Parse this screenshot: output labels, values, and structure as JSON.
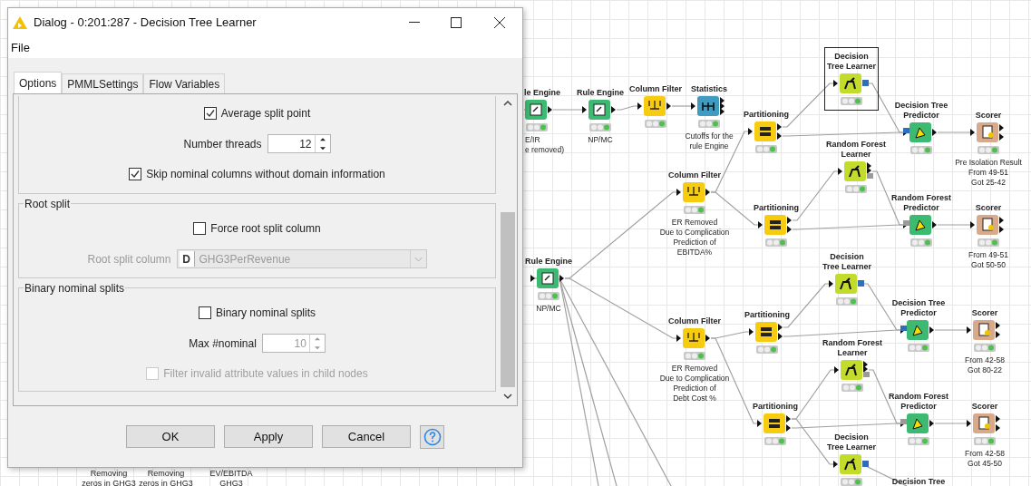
{
  "dialog": {
    "title": "Dialog - 0:201:287 - Decision Tree Learner",
    "menu": [
      "File"
    ],
    "tabs": [
      {
        "label": "Options",
        "selected": true
      },
      {
        "label": "PMMLSettings",
        "selected": false
      },
      {
        "label": "Flow Variables",
        "selected": false
      }
    ],
    "sections": [
      {
        "items": [
          {
            "kind": "checkbox",
            "label": "Average split point",
            "checked": true,
            "disabled": false
          },
          {
            "kind": "spinner",
            "label": "Number threads",
            "value": "12",
            "disabled": false
          },
          {
            "kind": "checkbox",
            "label": "Skip nominal columns without domain information",
            "checked": true,
            "disabled": false
          }
        ]
      },
      {
        "title": "Root split",
        "items": [
          {
            "kind": "checkbox",
            "label": "Force root split column",
            "checked": false,
            "disabled": false
          },
          {
            "kind": "dropdown",
            "label": "Root split column",
            "type_badge": "D",
            "value": "GHG3PerRevenue",
            "disabled": true
          }
        ]
      },
      {
        "title": "Binary nominal splits",
        "items": [
          {
            "kind": "checkbox",
            "label": "Binary nominal splits",
            "checked": false,
            "disabled": false
          },
          {
            "kind": "spinner",
            "label": "Max #nominal",
            "value": "10",
            "disabled": true
          },
          {
            "kind": "checkbox",
            "label": "Filter invalid attribute values in child nodes",
            "checked": false,
            "disabled": true
          }
        ]
      }
    ],
    "buttons": [
      "OK",
      "Apply",
      "Cancel"
    ]
  },
  "workflow": {
    "nodes": [
      {
        "kind": "rule",
        "label": [
          "le Engine"
        ],
        "caption": [
          "E/IR",
          "e removed)"
        ],
        "selected": false
      },
      {
        "kind": "rule",
        "label": [
          "Rule Engine"
        ],
        "caption": [
          "NP/MC"
        ],
        "selected": false
      },
      {
        "kind": "filter",
        "label": [
          "Column Filter"
        ],
        "selected": false
      },
      {
        "kind": "statistics",
        "label": [
          "Statistics"
        ],
        "caption": [
          "Cutoffs for the",
          "rule Engine"
        ],
        "selected": false
      },
      {
        "kind": "partition",
        "label": [
          "Partitioning"
        ],
        "selected": false
      },
      {
        "kind": "dt_learner",
        "label": [
          "Decision",
          "Tree Learner"
        ],
        "selected": true
      },
      {
        "kind": "dt_predictor",
        "label": [
          "Decision Tree",
          "Predictor"
        ],
        "selected": false
      },
      {
        "kind": "scorer",
        "label": [
          "Scorer"
        ],
        "caption": [
          "Pre Isolation Result",
          "From 49-51",
          "Got 25-42"
        ],
        "selected": false
      },
      {
        "kind": "filter",
        "label": [
          "Column Filter"
        ],
        "caption": [
          "ER Removed",
          "Due to Complication",
          "Prediction of",
          "EBITDA%"
        ],
        "selected": false
      },
      {
        "kind": "partition",
        "label": [
          "Partitioning"
        ],
        "selected": false
      },
      {
        "kind": "rf_learner",
        "label": [
          "Random Forest",
          "Learner"
        ],
        "selected": false
      },
      {
        "kind": "rf_predictor",
        "label": [
          "Random Forest",
          "Predictor"
        ],
        "selected": false
      },
      {
        "kind": "scorer",
        "label": [
          "Scorer"
        ],
        "caption": [
          "From 49-51",
          "Got 50-50"
        ],
        "selected": false
      },
      {
        "kind": "rule",
        "label": [
          "Rule Engine"
        ],
        "caption": [
          "NP/MC"
        ],
        "selected": false
      },
      {
        "kind": "filter",
        "label": [
          "Column Filter"
        ],
        "caption": [
          "ER Removed",
          "Due to Complication",
          "Prediction of",
          "Debt Cost %"
        ],
        "selected": false
      },
      {
        "kind": "partition",
        "label": [
          "Partitioning"
        ],
        "selected": false
      },
      {
        "kind": "dt_learner",
        "label": [
          "Decision",
          "Tree Learner"
        ],
        "selected": false
      },
      {
        "kind": "dt_predictor",
        "label": [
          "Decision Tree",
          "Predictor"
        ],
        "selected": false
      },
      {
        "kind": "scorer",
        "label": [
          "Scorer"
        ],
        "caption": [
          "From 42-58",
          "Got 80-22"
        ],
        "selected": false
      },
      {
        "kind": "rf_learner",
        "label": [
          "Random Forest",
          "Learner"
        ],
        "selected": false
      },
      {
        "kind": "partition",
        "label": [
          "Partitioning"
        ],
        "selected": false
      },
      {
        "kind": "rf_predictor",
        "label": [
          "Random Forest",
          "Predictor"
        ],
        "selected": false
      },
      {
        "kind": "scorer",
        "label": [
          "Scorer"
        ],
        "caption": [
          "From 42-58",
          "Got 45-50"
        ],
        "selected": false
      },
      {
        "kind": "dt_learner",
        "label": [
          "Decision",
          "Tree Learner"
        ],
        "selected": false
      }
    ],
    "partial_texts": [
      "Removing",
      "zeros in GHG3",
      "Removing",
      "zeros in GHG3",
      "EV/EBITDA",
      "GHG3",
      "Decision Tree"
    ]
  }
}
